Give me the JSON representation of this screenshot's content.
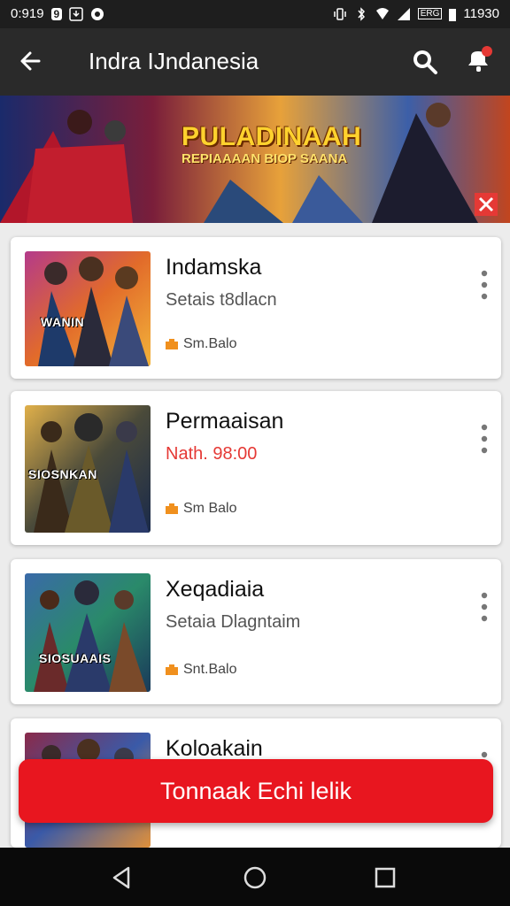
{
  "status_bar": {
    "time": "0:919",
    "badge": "9",
    "battery_text": "ERG",
    "right_time": "11930"
  },
  "app_bar": {
    "title": "Indra IJndanesia"
  },
  "banner": {
    "title": "PULADINAAH",
    "subtitle": "REPIAAAAN BIOP SAANA"
  },
  "items": [
    {
      "name": "Indamska",
      "desc": "Setais t8dlacn",
      "meta": "Sm.Balo",
      "thumb_text": "WANIN"
    },
    {
      "name": "Permaaisan",
      "desc": "Nath. 98:00",
      "meta": "Sm Balo",
      "thumb_text": "SIOSNKAN"
    },
    {
      "name": "Xeqadiaia",
      "desc": "Setaia Dlagntaim",
      "meta": "Snt.Balo",
      "thumb_text": "SIOSUAAIS"
    },
    {
      "name": "Koloakain",
      "desc": "",
      "meta": "",
      "thumb_text": ""
    }
  ],
  "fab": {
    "label": "Tonnaak Echi lelik"
  },
  "colors": {
    "accent": "#e8161f",
    "appbar": "#2a2a2a",
    "price": "#e53935"
  }
}
